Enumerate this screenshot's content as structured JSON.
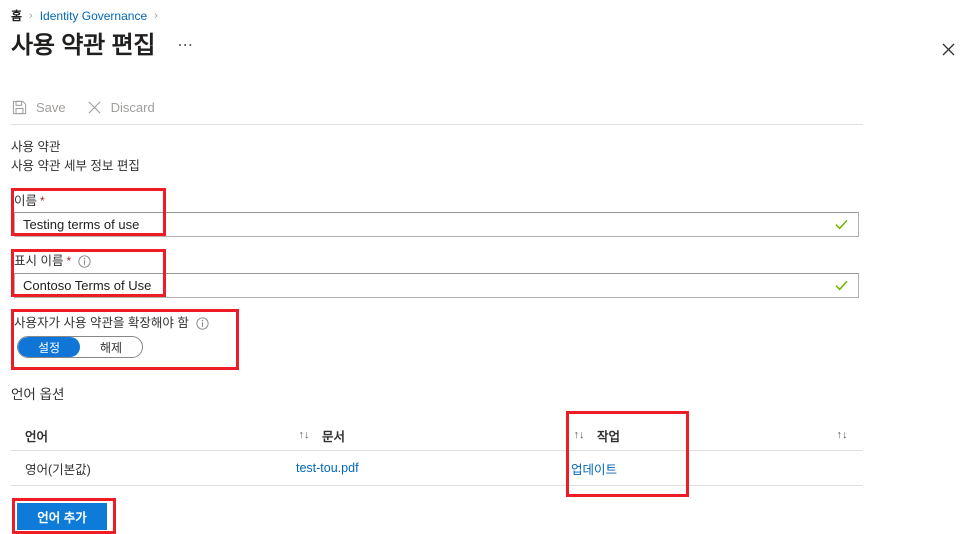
{
  "breadcrumb": {
    "home": "홈",
    "separator": "›",
    "section": "Identity Governance"
  },
  "header": {
    "title": "사용 약관 편집",
    "ellipsis": "⋯",
    "close_icon": "close-icon"
  },
  "command_bar": {
    "save_label": "Save",
    "save_icon": "save-floppy-icon",
    "discard_label": "Discard",
    "discard_icon": "close-x-icon"
  },
  "section": {
    "heading": "사용 약관",
    "subheading": "사용 약관 세부 정보 편집"
  },
  "fields": {
    "name": {
      "label": "이름",
      "required_mark": "*",
      "value": "Testing terms of use",
      "valid": true
    },
    "display_name": {
      "label": "표시 이름",
      "required_mark": "*",
      "info_icon": "info-icon",
      "value": "Contoso Terms of Use",
      "valid": true
    },
    "require_expand": {
      "label": "사용자가 사용 약관을 확장해야 함",
      "info_icon": "info-icon",
      "option_on": "설정",
      "option_off": "해제",
      "selected": "설정"
    }
  },
  "language_options": {
    "heading": "언어 옵션",
    "columns": {
      "language": "언어",
      "document": "문서",
      "action": "작업"
    },
    "sort_icon": "sort-updown-icon",
    "rows": [
      {
        "language": "영어(기본값)",
        "document": "test-tou.pdf",
        "action": "업데이트"
      }
    ],
    "add_button": "언어 추가"
  },
  "colors": {
    "accent_blue": "#0f7bd8",
    "link_blue": "#0067b8",
    "annotation_red": "#ee1c25",
    "valid_green": "#6bb700",
    "required_red": "#a4262c"
  }
}
